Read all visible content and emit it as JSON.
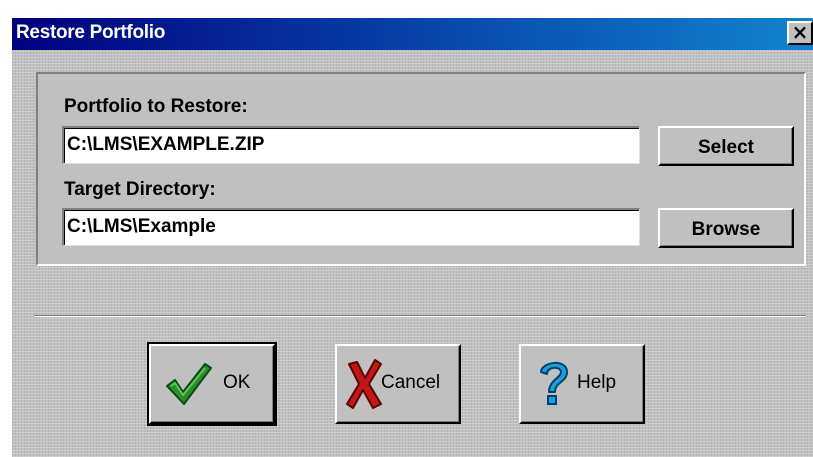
{
  "window": {
    "title": "Restore Portfolio",
    "close_glyph": "×"
  },
  "form": {
    "portfolio_label": "Portfolio to Restore:",
    "portfolio_value": "C:\\LMS\\EXAMPLE.ZIP",
    "select_label": "Select",
    "target_label": "Target Directory:",
    "target_value": "C:\\LMS\\Example",
    "browse_label": "Browse"
  },
  "buttons": {
    "ok_label": "OK",
    "cancel_label": "Cancel",
    "help_label": "Help"
  },
  "icons": {
    "ok": "checkmark-icon",
    "cancel": "red-x-icon",
    "help": "question-mark-icon",
    "close": "close-icon"
  },
  "colors": {
    "title_start": "#000080",
    "title_end": "#1084d0",
    "face": "#c0c0c0",
    "check_green": "#008000",
    "x_red": "#c00000",
    "question_blue": "#0080c0"
  }
}
